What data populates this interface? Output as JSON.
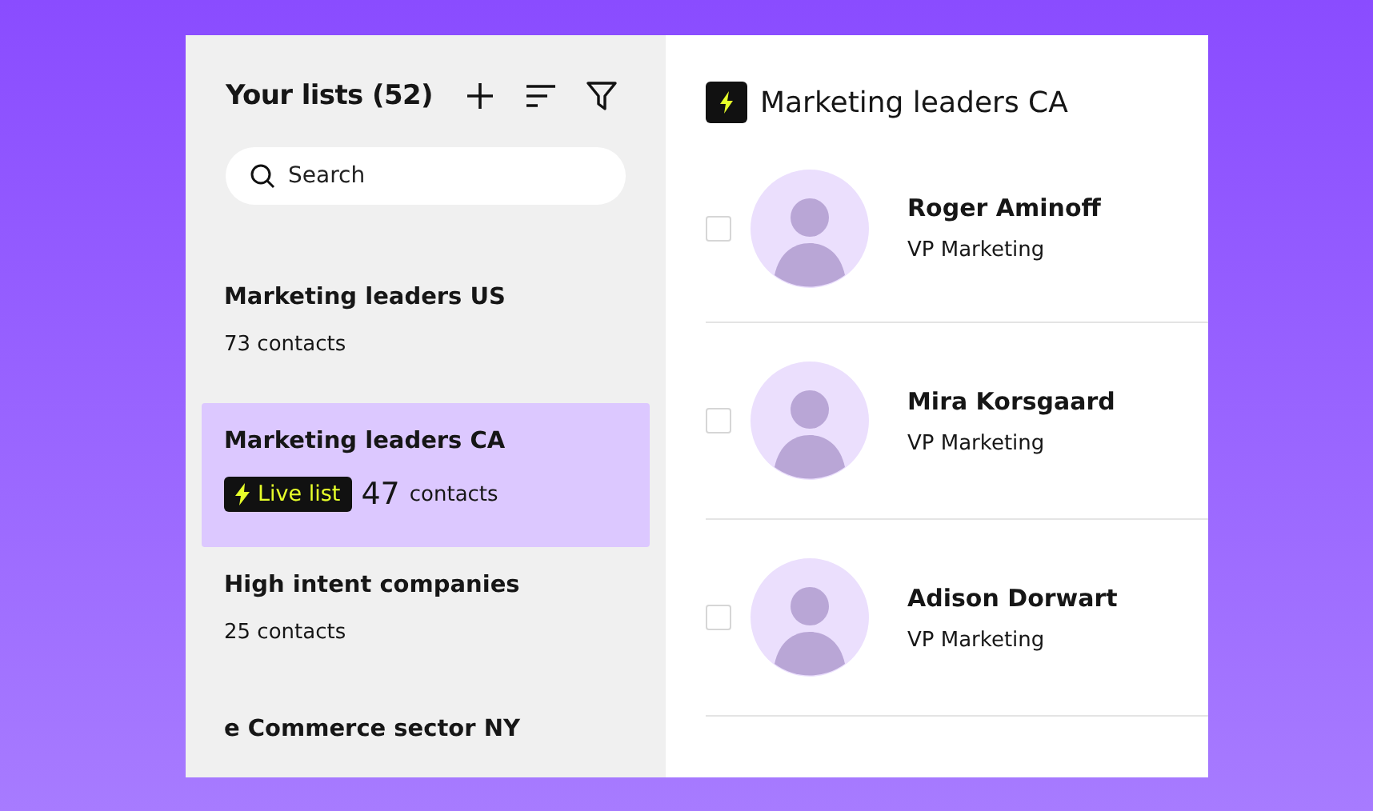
{
  "sidebar": {
    "title": "Your lists (52)",
    "search": {
      "placeholder": "Search"
    },
    "items": [
      {
        "name": "Marketing leaders US",
        "count": "73",
        "unit": "contacts",
        "live": false,
        "selected": false
      },
      {
        "name": "Marketing leaders CA",
        "badge": "Live list",
        "count": "47",
        "unit": "contacts",
        "live": true,
        "selected": true
      },
      {
        "name": "High intent companies",
        "count": "25",
        "unit": "contacts",
        "live": false,
        "selected": false
      },
      {
        "name": "e Commerce sector NY",
        "live": false,
        "selected": false
      }
    ]
  },
  "detail": {
    "title": "Marketing leaders CA",
    "contacts": [
      {
        "name": "Roger Aminoff",
        "role": "VP Marketing",
        "checked": false
      },
      {
        "name": "Mira Korsgaard",
        "role": "VP Marketing",
        "checked": false
      },
      {
        "name": "Adison Dorwart",
        "role": "VP Marketing",
        "checked": false
      }
    ]
  }
}
